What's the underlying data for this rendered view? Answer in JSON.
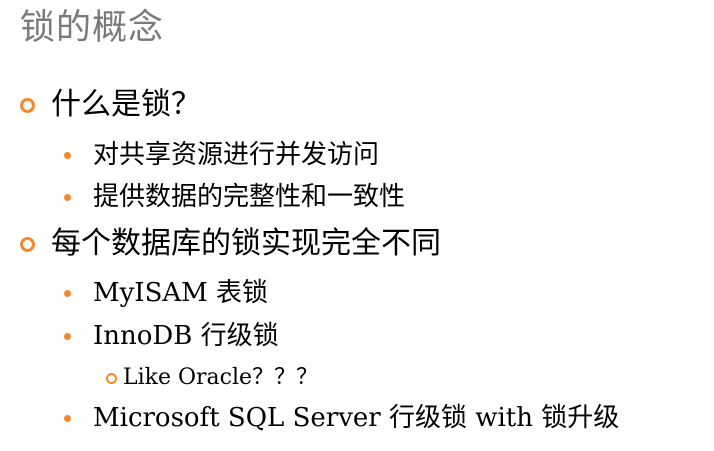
{
  "slide": {
    "title": "锁的概念",
    "items": [
      {
        "level": 1,
        "text": "什么是锁？"
      },
      {
        "level": 2,
        "text": "对共享资源进行并发访问"
      },
      {
        "level": 2,
        "text": "提供数据的完整性和一致性"
      },
      {
        "level": 1,
        "text": "每个数据库的锁实现完全不同"
      },
      {
        "level": 2,
        "text": "MyISAM 表锁"
      },
      {
        "level": 2,
        "text": "InnoDB 行级锁"
      },
      {
        "level": 3,
        "text": "Like Oracle？？？"
      },
      {
        "level": 2,
        "text": "Microsoft SQL Server 行级锁 with 锁升级"
      }
    ]
  },
  "colors": {
    "title": "#7a7a7a",
    "bullet": "#f08a2c",
    "text": "#000000"
  },
  "icons": {
    "level1_bullet": "hollow-circle-bullet",
    "level2_bullet": "filled-dot-bullet",
    "level3_bullet": "small-hollow-circle-bullet"
  }
}
